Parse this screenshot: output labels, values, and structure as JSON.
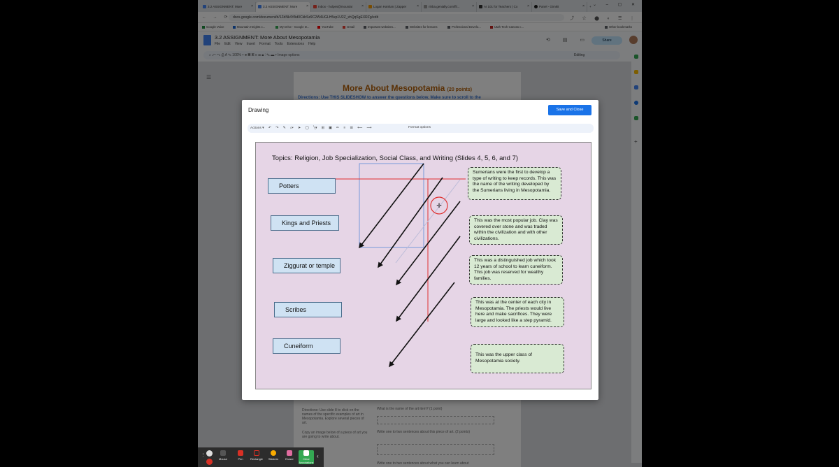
{
  "browser": {
    "tabs": [
      {
        "label": "3.2 ASSIGNMENT: More"
      },
      {
        "label": "3.2 ASSIGNMENT: More"
      },
      {
        "label": "Inbox - holpes@mountai"
      },
      {
        "label": "Logan Hamlan | Zapper"
      },
      {
        "label": "nhba.genially.com/fl/..."
      },
      {
        "label": "AI 101 for Teachers | Co"
      },
      {
        "label": "Panel - Gimkit"
      }
    ],
    "url": "docs.google.com/document/d/1ZdNk4YAd0CkbSz9C2W4UGLH5xp1U2Z_xhQqSgEXRZg/edit",
    "bookmarks": [
      {
        "label": "Google Voice"
      },
      {
        "label": "Mountain Heights c..."
      },
      {
        "label": "My Drive - Google D..."
      },
      {
        "label": "YouTube"
      },
      {
        "label": "Gmail"
      },
      {
        "label": "Important websites..."
      },
      {
        "label": "Websites for lessons"
      },
      {
        "label": "Professional Develo..."
      },
      {
        "label": "Utah Tech Canvas c..."
      },
      {
        "label": "Other bookmarks"
      }
    ]
  },
  "doc": {
    "title": "3.2 ASSIGNMENT: More About Mesopotamia",
    "menu": [
      "File",
      "Edit",
      "View",
      "Insert",
      "Format",
      "Tools",
      "Extensions",
      "Help"
    ],
    "share_label": "Share",
    "zoom": "100%",
    "toolbar_image_options": "Image options",
    "editing_label": "Editing",
    "page_title": "More About Mesopotamia",
    "page_points": "(20 points)",
    "page_directions": "Directions: Use THIS SLIDESHOW to answer the questions below. Make sure to scroll to the",
    "below": {
      "directions": "Directions: Use slide 8 to click on the names of the specific examples of art in Mesopotamia. Explore several pieces of art.",
      "copy": "Copy an image below of a piece of art you are going to write about.",
      "q1": "What is the name of the art item? (1 point)",
      "q2": "Write one to two sentences about this piece of art. (2 points)",
      "q3": "Write one to two sentences about what you can learn about"
    }
  },
  "drawing": {
    "title": "Drawing",
    "save_label": "Save and Close",
    "actions_label": "Actions",
    "format_options": "Format options",
    "topics": "Topics:  Religion, Job Specialization, Social Class, and Writing (Slides 4, 5, 6, and 7)",
    "terms": [
      "Potters",
      "Kings and Priests",
      "Ziggurat or temple",
      "Scribes",
      "Cuneiform"
    ],
    "definitions": [
      "Sumerians were the first to develop a type of writing to keep records.  This was the name of the writing developed by the Sumerians living in Mesopotamia.",
      "This was the most popular job.  Clay was covered over stone and was traded within the civilization and with other civilizations.",
      "This was a distinguished job which took 12 years of school to learn cuneiform.  This job was reserved for wealthy families.",
      "This was at the center of each city in Mesopotamia.  The priests would live here and make sacrifices.  They were large and looked like a step pyramid.",
      "This was the upper class of Mesopotamia society."
    ]
  },
  "taskbar": {
    "items": [
      {
        "label": "Mouse",
        "icon": "mouse-icon"
      },
      {
        "label": "Pen",
        "icon": "pen-icon"
      },
      {
        "label": "Rectangle",
        "icon": "rectangle-icon"
      },
      {
        "label": "Stickers",
        "icon": "sticker-icon"
      },
      {
        "label": "Eraser",
        "icon": "eraser-icon"
      },
      {
        "label": "Clear Annotations",
        "icon": "clear-icon"
      }
    ]
  }
}
